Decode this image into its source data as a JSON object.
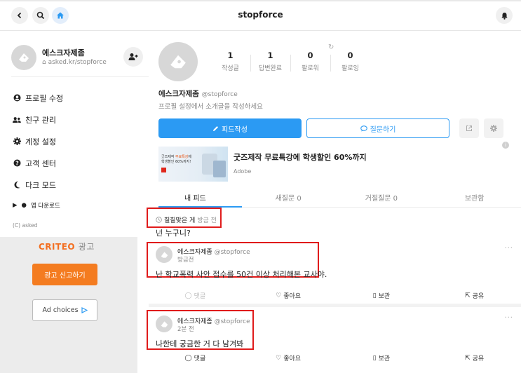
{
  "topbar": {
    "title": "stopforce"
  },
  "sidebar": {
    "profile_name": "에스크자제좀",
    "profile_url": "asked.kr/stopforce",
    "menu": [
      "프로필 수정",
      "친구 관리",
      "계정 설정",
      "고객 센터",
      "다크 모드"
    ],
    "app_download": "앱 다운로드",
    "copyright": "(C) asked",
    "ad_label_brand": "CRITEO",
    "ad_label_suffix": "광고",
    "report_ad": "광고 신고하기",
    "ad_choices": "Ad choices"
  },
  "profile": {
    "stats": [
      {
        "value": "1",
        "label": "작성글"
      },
      {
        "value": "1",
        "label": "답변완료"
      },
      {
        "value": "0",
        "label": "팔로워"
      },
      {
        "value": "0",
        "label": "팔로잉"
      }
    ],
    "name": "에스크자제좀",
    "handle": "@stopforce",
    "bio_placeholder": "프로필 설정에서 소개글을 작성하세요",
    "feed_write": "피드작성",
    "ask": "질문하기"
  },
  "ad_banner": {
    "thumb_line1_a": "굿즈제작",
    "thumb_line1_b": "무료특강",
    "thumb_line1_c": "에",
    "thumb_line2": "학생할인 60%까지!",
    "title": "굿즈제작 무료특강에 학생할인 60%까지",
    "brand": "Adobe"
  },
  "tabs": [
    "내 피드",
    "새질문 0",
    "거절질문 0",
    "보관함"
  ],
  "question": {
    "asker": "칠칠맞은 게",
    "time": "방금 전",
    "text": "넌 누구니?"
  },
  "answers": [
    {
      "name": "에스크자제좀",
      "handle": "@stopforce",
      "time": "방금전",
      "text": "난 학교폭력 사안 접수를 50건 이상 처리해본 교사야."
    },
    {
      "name": "에스크자제좀",
      "handle": "@stopforce",
      "time": "2분 전",
      "text": "나한테 궁금한 거 다 남겨봐"
    }
  ],
  "actions": {
    "comment": "댓글",
    "like": "좋아요",
    "save": "보관",
    "share": "공유"
  },
  "colors": {
    "accent": "#2b9af3",
    "report": "#f47c20",
    "highlight": "#e01b1b"
  }
}
